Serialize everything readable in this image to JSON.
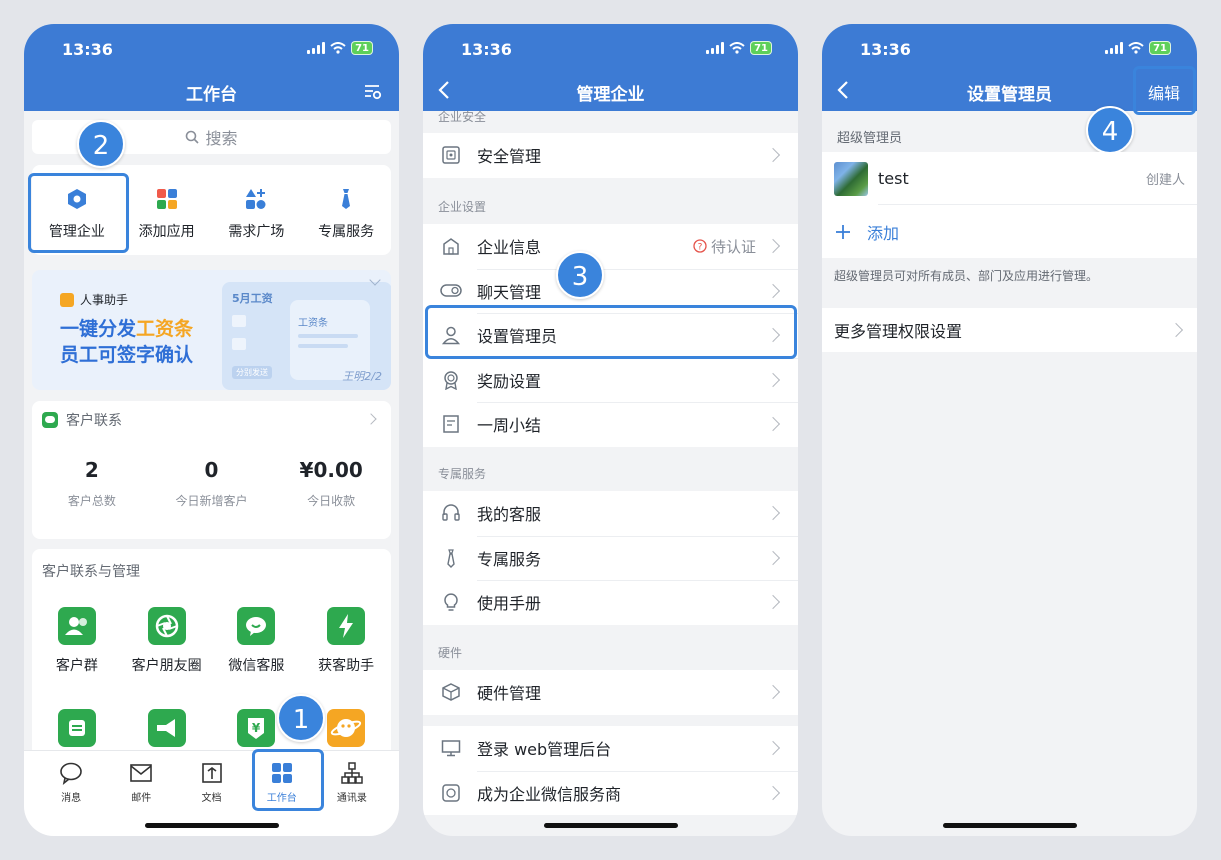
{
  "status": {
    "time": "13:36",
    "battery": "71"
  },
  "colors": {
    "brand": "#3d7bd4",
    "accent": "#3a84dc",
    "green": "#2ea94f",
    "orange": "#f5a623",
    "warn": "#e5534b"
  },
  "steps": [
    "1",
    "2",
    "3",
    "4"
  ],
  "phone1": {
    "title": "工作台",
    "search_placeholder": "搜索",
    "quick": [
      {
        "label": "管理企业",
        "icon": "hexagon-icon"
      },
      {
        "label": "添加应用",
        "icon": "apps-grid-icon"
      },
      {
        "label": "需求广场",
        "icon": "shapes-plus-icon"
      },
      {
        "label": "专属服务",
        "icon": "tie-icon"
      }
    ],
    "banner": {
      "tag": "人事助手",
      "line1_a": "一键分发",
      "line1_b": "工资条",
      "line2": "员工可签字确认",
      "card_title": "5月工资",
      "card_sub": "工资条",
      "btn": "分别发送",
      "sign": "王明2/2"
    },
    "stats": {
      "title": "客户联系",
      "items": [
        {
          "value": "2",
          "label": "客户总数"
        },
        {
          "value": "0",
          "label": "今日新增客户"
        },
        {
          "value": "¥0.00",
          "label": "今日收款"
        }
      ]
    },
    "tools": {
      "title": "客户联系与管理",
      "items": [
        "客户群",
        "客户朋友圈",
        "微信客服",
        "获客助手"
      ]
    },
    "tabs": [
      "消息",
      "邮件",
      "文档",
      "工作台",
      "通讯录"
    ]
  },
  "phone2": {
    "title": "管理企业",
    "sec_security": "企业安全",
    "security_rows": [
      "安全管理"
    ],
    "sec_settings": "企业设置",
    "settings_rows": [
      "企业信息",
      "聊天管理",
      "设置管理员",
      "奖励设置",
      "一周小结"
    ],
    "pending": "待认证",
    "sec_service": "专属服务",
    "service_rows": [
      "我的客服",
      "专属服务",
      "使用手册"
    ],
    "sec_hardware": "硬件",
    "hardware_rows": [
      "硬件管理"
    ],
    "other_rows": [
      "登录 web管理后台",
      "成为企业微信服务商"
    ]
  },
  "phone3": {
    "title": "设置管理员",
    "edit": "编辑",
    "section": "超级管理员",
    "user": "test",
    "creator": "创建人",
    "add": "添加",
    "note": "超级管理员可对所有成员、部门及应用进行管理。",
    "more": "更多管理权限设置"
  }
}
